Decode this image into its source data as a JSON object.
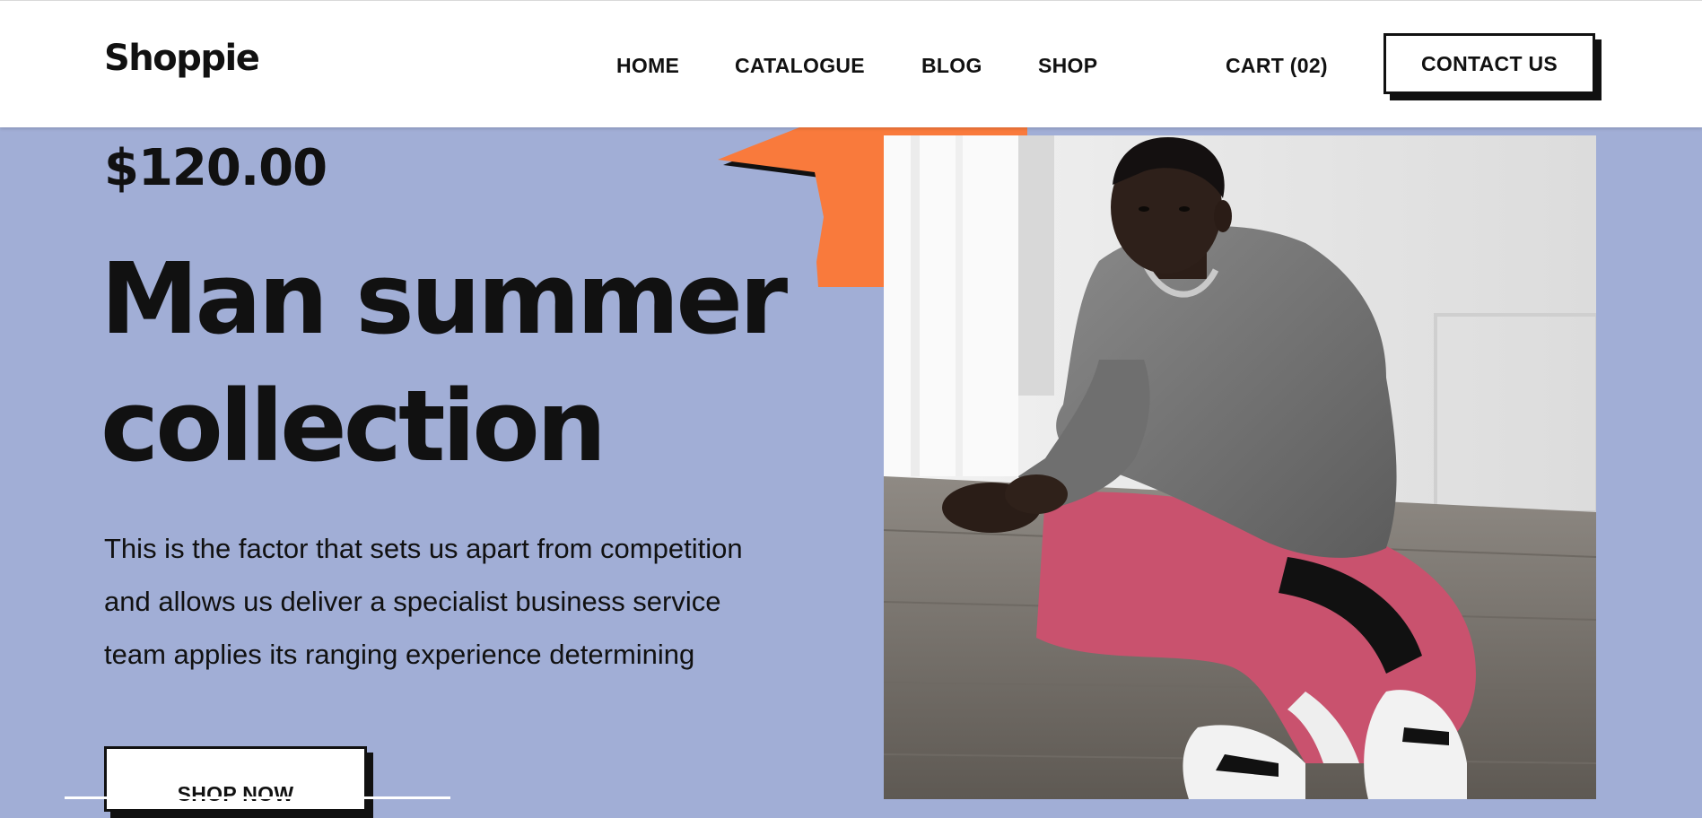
{
  "header": {
    "logo": "Shoppie",
    "nav": [
      {
        "label": "HOME",
        "name": "nav-home"
      },
      {
        "label": "CATALOGUE",
        "name": "nav-catalogue"
      },
      {
        "label": "BLOG",
        "name": "nav-blog"
      },
      {
        "label": "SHOP",
        "name": "nav-shop"
      },
      {
        "label": "CART (02)",
        "name": "nav-cart"
      }
    ],
    "contact_label": "CONTACT US"
  },
  "hero": {
    "price": "$120.00",
    "headline_line1": "Man summer",
    "headline_line2": "collection",
    "description_line1": "This is the factor that sets us apart from competition",
    "description_line2": "and allows us deliver a specialist business service",
    "description_line3": "team applies its ranging experience determining",
    "cta_label": "SHOP NOW"
  },
  "colors": {
    "background": "#a1aed6",
    "accent_star": "#f97a3c",
    "text": "#111111",
    "header_bg": "#ffffff"
  },
  "icons": {
    "decoration": "star-burst-icon",
    "photo": "model-photo"
  }
}
